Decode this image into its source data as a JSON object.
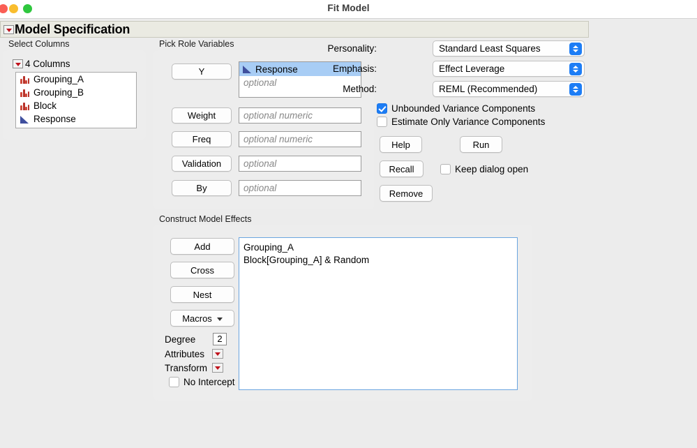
{
  "window": {
    "title": "Fit Model",
    "traffic_lights": [
      "close-button",
      "minimize-button",
      "zoom-button"
    ]
  },
  "spec_header": {
    "title": "Model Specification"
  },
  "select_columns": {
    "group_label": "Select Columns",
    "count_label": "4 Columns",
    "columns": [
      {
        "name": "Grouping_A",
        "type": "nominal"
      },
      {
        "name": "Grouping_B",
        "type": "nominal"
      },
      {
        "name": "Block",
        "type": "nominal"
      },
      {
        "name": "Response",
        "type": "continuous"
      }
    ]
  },
  "pick_role": {
    "group_label": "Pick Role Variables",
    "rows": [
      {
        "button": "Y",
        "value": "Response",
        "value_type": "continuous",
        "placeholder": "optional",
        "selected": true
      },
      {
        "button": "Weight",
        "value": "",
        "placeholder": "optional numeric"
      },
      {
        "button": "Freq",
        "value": "",
        "placeholder": "optional numeric"
      },
      {
        "button": "Validation",
        "value": "",
        "placeholder": "optional"
      },
      {
        "button": "By",
        "value": "",
        "placeholder": "optional"
      }
    ]
  },
  "options": {
    "personality_label": "Personality:",
    "personality_value": "Standard Least Squares",
    "emphasis_label": "Emphasis:",
    "emphasis_value": "Effect Leverage",
    "method_label": "Method:",
    "method_value": "REML (Recommended)",
    "unbounded_label": "Unbounded Variance Components",
    "unbounded_checked": true,
    "estimate_only_label": "Estimate Only Variance Components",
    "estimate_only_checked": false,
    "help_label": "Help",
    "run_label": "Run",
    "recall_label": "Recall",
    "remove_label": "Remove",
    "keep_open_label": "Keep dialog open",
    "keep_open_checked": false
  },
  "effects": {
    "group_label": "Construct Model Effects",
    "add_label": "Add",
    "cross_label": "Cross",
    "nest_label": "Nest",
    "macros_label": "Macros",
    "degree_label": "Degree",
    "degree_value": "2",
    "attributes_label": "Attributes",
    "transform_label": "Transform",
    "no_intercept_label": "No Intercept",
    "no_intercept_checked": false,
    "items": [
      "Grouping_A",
      "Block[Grouping_A] & Random"
    ]
  },
  "colors": {
    "accent_blue": "#1d7df5",
    "selection_blue": "#a8cdf5",
    "nominal_red": "#c0392f",
    "continuous_blue": "#3f4f9e",
    "disclosure_red": "#c0121b"
  }
}
